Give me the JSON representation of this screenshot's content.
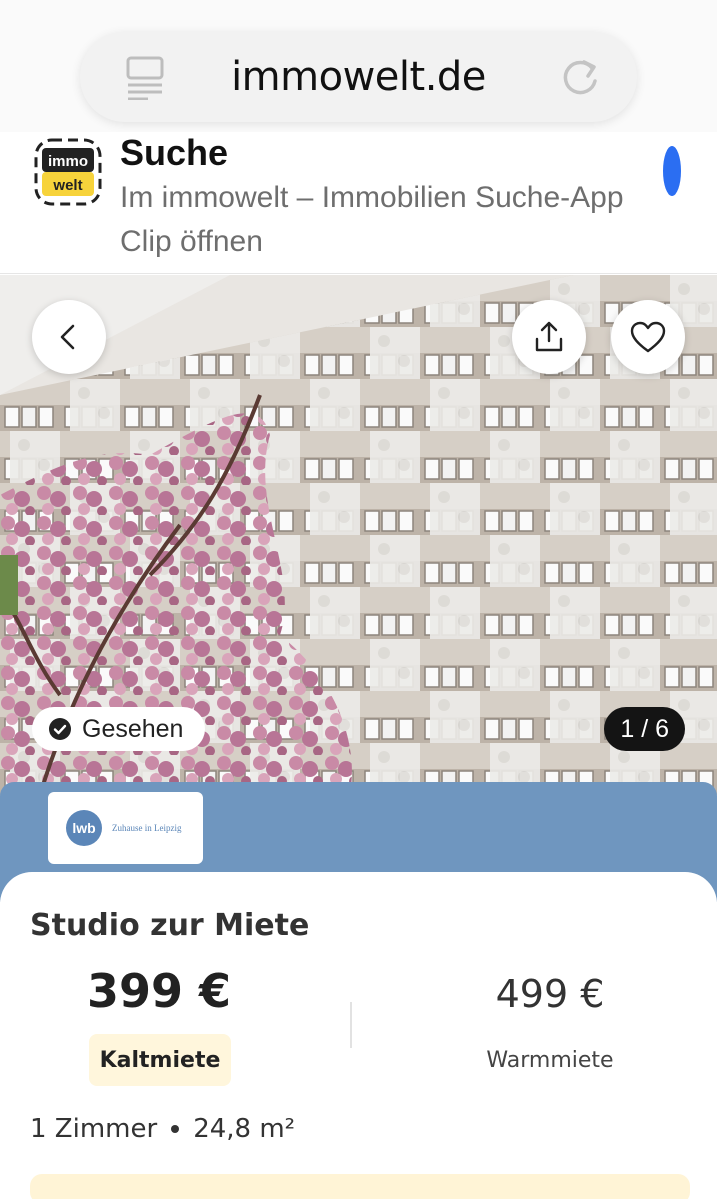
{
  "browser": {
    "url": "immowelt.de",
    "reader_icon": "reader-mode-icon",
    "reload_icon": "reload-icon"
  },
  "app_clip": {
    "app_icon_top": "immo",
    "app_icon_bottom": "welt",
    "title": "Suche",
    "subtitle": "Im immowelt – Immobilien Suche-App Clip öffnen"
  },
  "gallery": {
    "back_icon": "chevron-left-icon",
    "share_icon": "share-icon",
    "favorite_icon": "heart-icon",
    "seen_label": "Gesehen",
    "seen_icon": "check-circle-icon",
    "counter": "1 / 6"
  },
  "provider": {
    "logo_mark": "lwb",
    "logo_tagline": "Zuhause in Leipzig"
  },
  "listing": {
    "title": "Studio zur Miete",
    "cold_rent": "399 €",
    "cold_rent_label": "Kaltmiete",
    "warm_rent": "499 €",
    "warm_rent_label": "Warmmiete",
    "rooms": "1 Zimmer",
    "area": "24,8 m²"
  },
  "colors": {
    "provider_blue": "#6f96bf",
    "badge_yellow": "#fff6dc",
    "accent_blue": "#2b6ef2"
  }
}
